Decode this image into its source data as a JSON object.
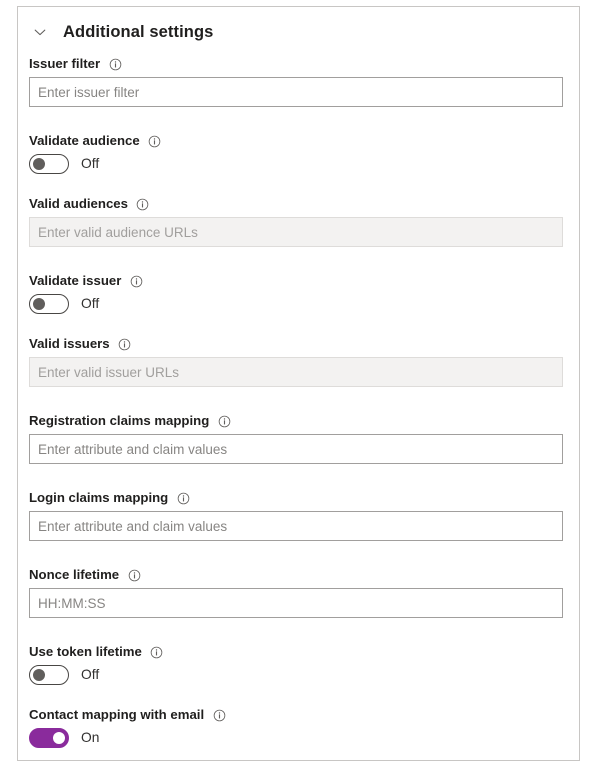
{
  "card": {
    "title": "Additional settings",
    "collapse_icon": "chevron-down-icon",
    "info_icon": "info-circle-icon"
  },
  "colors": {
    "toggle_on": "#8a2b9c",
    "toggle_off_knob": "#605e5c",
    "border": "#c8c6c4",
    "input_border": "#a19f9d",
    "disabled_bg": "#f3f2f1",
    "text": "#201f1e",
    "placeholder": "#878583"
  },
  "fields": [
    {
      "type": "text",
      "label": "Issuer filter",
      "placeholder": "Enter issuer filter",
      "value": "",
      "disabled": false,
      "name": "issuer-filter"
    },
    {
      "type": "toggle",
      "label": "Validate audience",
      "state_label": "Off",
      "on": false,
      "name": "validate-audience"
    },
    {
      "type": "text",
      "label": "Valid audiences",
      "placeholder": "Enter valid audience URLs",
      "value": "",
      "disabled": true,
      "name": "valid-audiences"
    },
    {
      "type": "toggle",
      "label": "Validate issuer",
      "state_label": "Off",
      "on": false,
      "name": "validate-issuer"
    },
    {
      "type": "text",
      "label": "Valid issuers",
      "placeholder": "Enter valid issuer URLs",
      "value": "",
      "disabled": true,
      "name": "valid-issuers"
    },
    {
      "type": "text",
      "label": "Registration claims mapping",
      "placeholder": "Enter attribute and claim values",
      "value": "",
      "disabled": false,
      "name": "registration-claims-mapping"
    },
    {
      "type": "text",
      "label": "Login claims mapping",
      "placeholder": "Enter attribute and claim values",
      "value": "",
      "disabled": false,
      "name": "login-claims-mapping"
    },
    {
      "type": "text",
      "label": "Nonce lifetime",
      "placeholder": "HH:MM:SS",
      "value": "",
      "disabled": false,
      "name": "nonce-lifetime"
    },
    {
      "type": "toggle",
      "label": "Use token lifetime",
      "state_label": "Off",
      "on": false,
      "name": "use-token-lifetime"
    },
    {
      "type": "toggle",
      "label": "Contact mapping with email",
      "state_label": "On",
      "on": true,
      "name": "contact-mapping-with-email"
    }
  ]
}
